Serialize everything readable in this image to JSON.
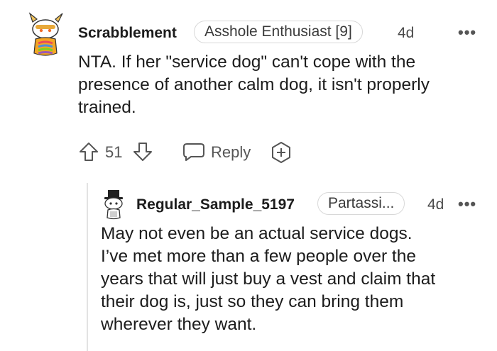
{
  "comment": {
    "username": "Scrabblement",
    "flair": "Asshole Enthusiast [9]",
    "age": "4d",
    "more": "•••",
    "body_lines": [
      "NTA. If her \"service dog\" can't cope with the",
      "presence of another calm dog, it isn't properly",
      "trained."
    ],
    "score": "51",
    "reply_label": "Reply"
  },
  "reply": {
    "username": "Regular_Sample_5197",
    "flair": "Partassi...",
    "age": "4d",
    "more": "•••",
    "body_lines": [
      "May not even be an actual service dogs.",
      "I’ve met more than a few people over the",
      "years that will just buy a vest and claim that",
      "their dog is, just so they can bring them",
      "wherever they want."
    ]
  },
  "icons": {
    "avatar1": "snoo-avatar-cat-ears",
    "avatar2": "snoo-avatar-top-hat",
    "upvote": "arrow-up-icon",
    "downvote": "arrow-down-icon",
    "reply": "speech-bubble-icon",
    "award": "award-plus-icon"
  }
}
